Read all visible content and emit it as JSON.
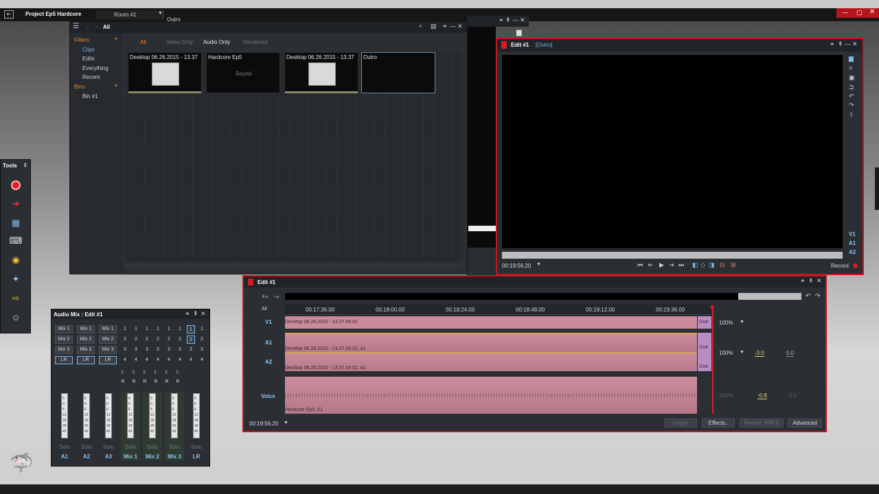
{
  "app": {
    "project_title": "Project Ep5 Hardcore",
    "room": "Room #1",
    "back_window_title": "Outro"
  },
  "library": {
    "breadcrumb": "All",
    "filters_label": "Filters",
    "filter_items": [
      "Clips",
      "Edits",
      "Everything",
      "Recent"
    ],
    "bins_label": "Bins",
    "bin_items": [
      "Bin #1"
    ],
    "tabs": [
      "All",
      "Video Only",
      "Audio Only",
      "Rendered"
    ],
    "thumbnails": [
      {
        "title": "Desktop 06.26.2015 - 13.37",
        "sub": ""
      },
      {
        "title": "Hardcore Ep5",
        "sub": "Sound"
      },
      {
        "title": "Desktop 06.26.2015 - 13.37",
        "sub": ""
      },
      {
        "title": "Outro",
        "sub": ""
      }
    ]
  },
  "viewer": {
    "title": "Edit #1",
    "subtitle": "[Outro]",
    "timecode": "00:19:56.20",
    "record_label": "Record",
    "tracks": [
      "V1",
      "A1",
      "A2"
    ]
  },
  "timeline": {
    "title": "Edit #1",
    "all_label": "All",
    "ruler": [
      "00:17:36.00",
      "00:18:00.00",
      "00:18:24.00",
      "00:18:48.00",
      "00:19:12.00",
      "00:19:36.00"
    ],
    "tracks": [
      {
        "label": "V1",
        "clip": "Desktop 06.26.2015 - 13.37.59.02",
        "end": "Outr",
        "zoom": "100%"
      },
      {
        "label": "A1",
        "clip": "Desktop 06.26.2015 - 13.37.59.02, A1",
        "end": "Outr",
        "zoom": "100%"
      },
      {
        "label": "A2",
        "clip": "Desktop 06.26.2015 - 13.37.59.02, A2",
        "end": "Outr"
      },
      {
        "label": "Voice",
        "clip": "Hardcore Ep5, A1"
      }
    ],
    "a_gain": "-3.0",
    "a_pan": "0.0",
    "voice_zoom": "100%",
    "voice_gain": "-0.8",
    "voice_pan": "0.0",
    "timecode": "00:19:56.20",
    "buttons": {
      "unjoin": "Unjoin",
      "effects": "Effects..",
      "render": "Render (PRO)",
      "advanced": "Advanced"
    }
  },
  "audiomix": {
    "title": "Audio Mix : Edit #1",
    "mix_rows": [
      [
        "Mix 1",
        "Mix 1",
        "Mix 1"
      ],
      [
        "Mix 2",
        "Mix 2",
        "Mix 2"
      ],
      [
        "Mix 3",
        "Mix 3",
        "Mix 3"
      ],
      [
        "LR",
        "LR",
        "LR"
      ]
    ],
    "num_rows": [
      [
        "1",
        "1",
        "1",
        "1",
        "1",
        "1",
        "1",
        "1"
      ],
      [
        "2",
        "2",
        "2",
        "2",
        "2",
        "2",
        "2",
        "2"
      ],
      [
        "3",
        "3",
        "3",
        "3",
        "3",
        "3",
        "3",
        "3"
      ],
      [
        "4",
        "4",
        "4",
        "4",
        "4",
        "4",
        "4",
        "4"
      ]
    ],
    "lr_l": "L",
    "lr_r": "R",
    "fader_scale": [
      "6",
      "0",
      "6",
      "12",
      "18",
      "30",
      "42"
    ],
    "solo_label": "Solo",
    "channels": [
      "A1",
      "A2",
      "A3",
      "Mix 1",
      "Mix 2",
      "Mix 3",
      "LR"
    ]
  },
  "tools": {
    "title": "Tools"
  }
}
